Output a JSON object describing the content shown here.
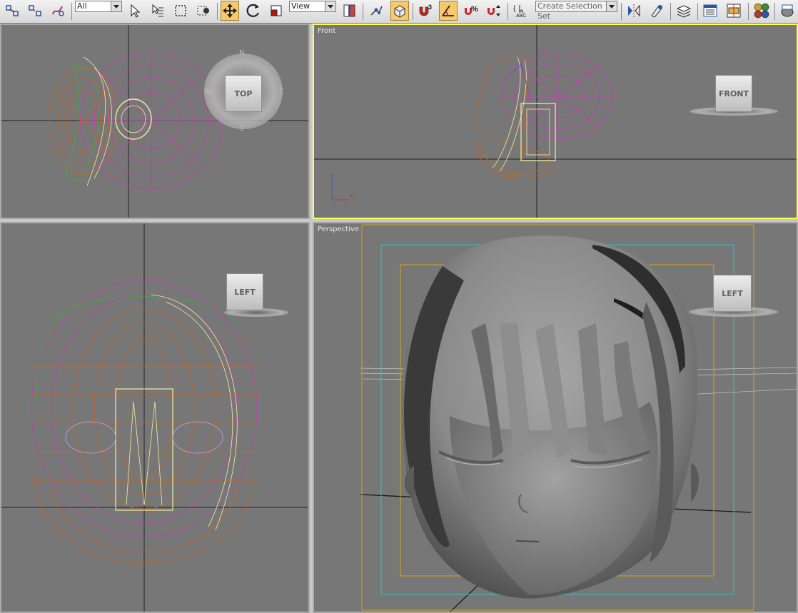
{
  "toolbar": {
    "selection_filter": "All",
    "reference_coord_system": "View",
    "named_selection_placeholder": "Create Selection Set",
    "snap_label": "3",
    "angle_snap_label": "%",
    "edit_named_label": "ABC"
  },
  "viewports": {
    "top": {
      "label": "",
      "viewcube_label": "TOP",
      "compass": {
        "n": "N",
        "s": "S",
        "e": "E",
        "w": "W"
      }
    },
    "front": {
      "label": "Front",
      "viewcube_label": "FRONT",
      "axis_z": "z",
      "axis_x": "x"
    },
    "left": {
      "label": "",
      "viewcube_label": "LEFT"
    },
    "perspective": {
      "label": "Perspective",
      "viewcube_label": "LEFT"
    }
  },
  "colors": {
    "viewport_bg": "#777777",
    "active_border": "#ffff55",
    "wire_magenta": "#c83cb4",
    "wire_orange": "#c8641e",
    "wire_yellow": "#f0f0a0",
    "wire_green": "#3caa3c",
    "safe_frame_outer": "#d4a017",
    "safe_frame_inner": "#2ec4c4"
  }
}
